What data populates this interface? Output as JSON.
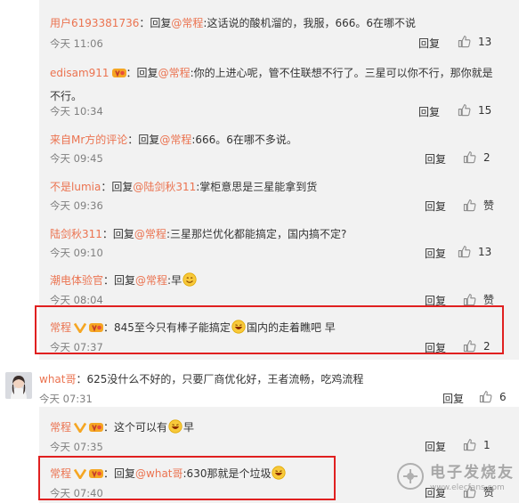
{
  "reply_label": "回复",
  "comments": [
    {
      "user": "用户6193381736",
      "sep": "：",
      "reply_word": "回复",
      "at": "@常程",
      "text": ":这话说的酸机溜的，我服，666。6在哪不说",
      "time": "今天 11:06",
      "like": "13"
    },
    {
      "user": "edisam911",
      "sep": "：回复",
      "reply_word": "",
      "at": "@常程",
      "text": ":你的上进心呢，管不住联想不行了。三星可以你不行，那你就是不行。",
      "time": "今天 10:34",
      "like": "15"
    },
    {
      "user": "来自Mr方的评论",
      "sep": "：回复",
      "reply_word": "",
      "at": "@常程",
      "text": ":666。6在哪不多说。",
      "time": "今天 09:45",
      "like": "2"
    },
    {
      "user": "不是lumia",
      "sep": "：回复",
      "reply_word": "",
      "at": "@陆剑秋311",
      "text": ":掌柜意思是三星能拿到货",
      "time": "今天 09:36",
      "like": "赞"
    },
    {
      "user": "陆剑秋311",
      "sep": "：回复",
      "reply_word": "",
      "at": "@常程",
      "text": ":三星那烂优化都能搞定，国内搞不定?",
      "time": "今天 09:10",
      "like": "13"
    },
    {
      "user": "潮电体验官",
      "sep": "：回复",
      "reply_word": "",
      "at": "@常程",
      "text": ":早",
      "time": "今天 08:04",
      "like": "赞"
    },
    {
      "user": "常程",
      "sep": "：",
      "text_a": "845至今只有棒子能搞定",
      "text_b": "国内的走着瞧吧 早",
      "time": "今天 07:37",
      "like": "2"
    }
  ],
  "top_comment": {
    "user": "what哥",
    "sep": "：",
    "text": "625没什么不好的，只要厂商优化好，王者流畅，吃鸡流程",
    "time": "今天 07:31",
    "like": "6"
  },
  "sub_replies": [
    {
      "user": "常程",
      "sep": "：",
      "text_a": "这个可以有",
      "text_b": "早",
      "time": "今天 07:35",
      "like": "1"
    },
    {
      "user": "常程",
      "sep": "：回复",
      "at": "@what哥",
      "text": ":630那就是个垃圾",
      "time": "今天 07:40",
      "like": "赞"
    }
  ],
  "watermark": {
    "title": "电子发烧友",
    "url": "www.elecfans.com"
  }
}
